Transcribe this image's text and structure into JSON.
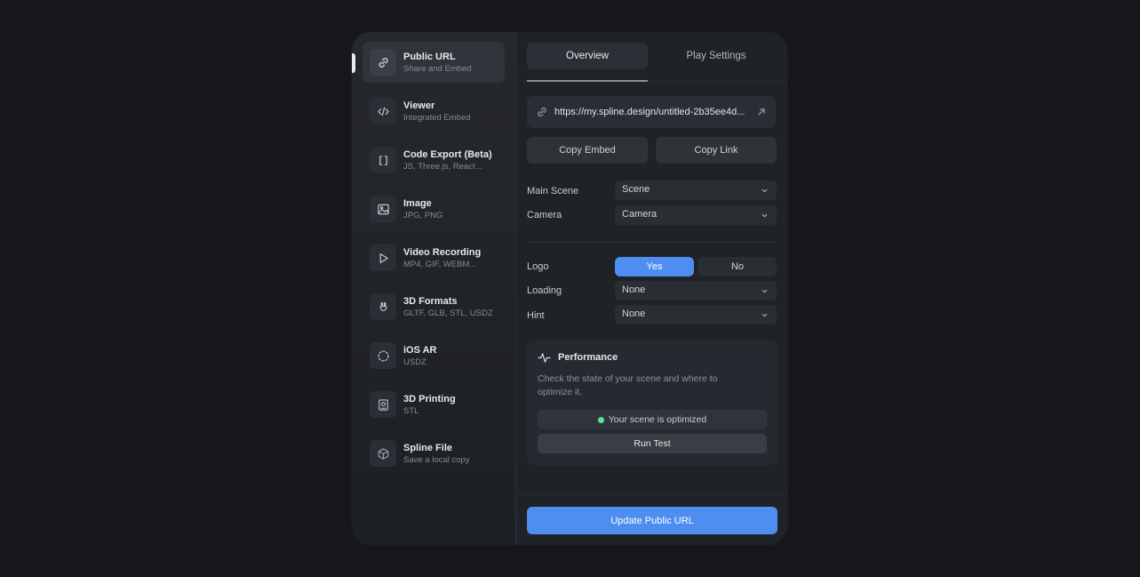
{
  "sidebar": {
    "items": [
      {
        "title": "Public URL",
        "subtitle": "Share and Embed",
        "icon": "link-icon"
      },
      {
        "title": "Viewer",
        "subtitle": "Integrated Embed",
        "icon": "code-icon"
      },
      {
        "title": "Code Export (Beta)",
        "subtitle": "JS, Three.js, React...",
        "icon": "brackets-icon"
      },
      {
        "title": "Image",
        "subtitle": "JPG, PNG",
        "icon": "image-icon"
      },
      {
        "title": "Video Recording",
        "subtitle": "MP4, GIF, WEBM...",
        "icon": "play-icon"
      },
      {
        "title": "3D Formats",
        "subtitle": "GLTF, GLB, STL, USDZ",
        "icon": "rabbit-icon"
      },
      {
        "title": "iOS AR",
        "subtitle": "USDZ",
        "icon": "ar-icon"
      },
      {
        "title": "3D Printing",
        "subtitle": "STL",
        "icon": "printer-icon"
      },
      {
        "title": "Spline File",
        "subtitle": "Save a local copy",
        "icon": "cube-icon"
      }
    ]
  },
  "tabs": {
    "overview": "Overview",
    "play_settings": "Play Settings"
  },
  "url": {
    "value": "https://my.spline.design/untitled-2b35ee4d..."
  },
  "actions": {
    "copy_embed": "Copy Embed",
    "copy_link": "Copy Link",
    "update": "Update Public URL"
  },
  "settings": {
    "main_scene_label": "Main Scene",
    "main_scene_value": "Scene",
    "camera_label": "Camera",
    "camera_value": "Camera",
    "logo_label": "Logo",
    "logo_yes": "Yes",
    "logo_no": "No",
    "loading_label": "Loading",
    "loading_value": "None",
    "hint_label": "Hint",
    "hint_value": "None"
  },
  "performance": {
    "title": "Performance",
    "description": "Check the state of your scene and where to optimize it.",
    "status": "Your scene is optimized",
    "run_test": "Run Test"
  },
  "colors": {
    "accent": "#4d8ef0",
    "status_ok": "#5ee29c",
    "background": "#15171b",
    "panel": "#1f2227"
  }
}
